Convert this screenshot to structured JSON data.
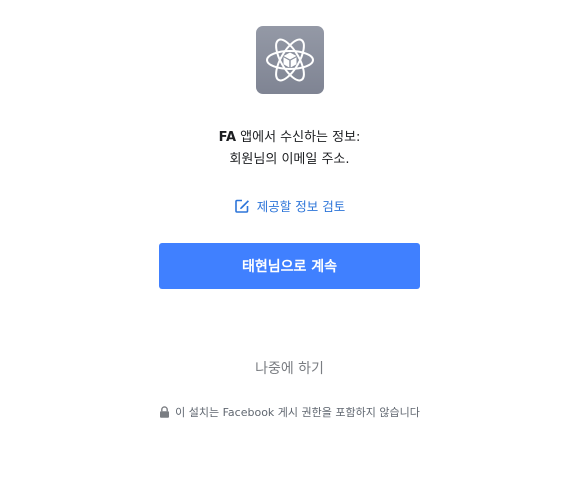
{
  "app": {
    "icon": "atom-cube-icon",
    "icon_background": "#8a8f9c"
  },
  "permissions": {
    "app_name": "FA",
    "line1_suffix": " 앱에서 수신하는 정보:",
    "line2": "회원님의 이메일 주소."
  },
  "review_link": {
    "icon": "edit-icon",
    "label": "제공할 정보 검토",
    "color": "#2d75d9"
  },
  "continue_button": {
    "label": "태현님으로 계속",
    "color": "#4080ff"
  },
  "later_button": {
    "label": "나중에 하기"
  },
  "footer": {
    "icon": "lock-icon",
    "note": "이 설치는 Facebook 게시 권한을 포함하지 않습니다"
  }
}
